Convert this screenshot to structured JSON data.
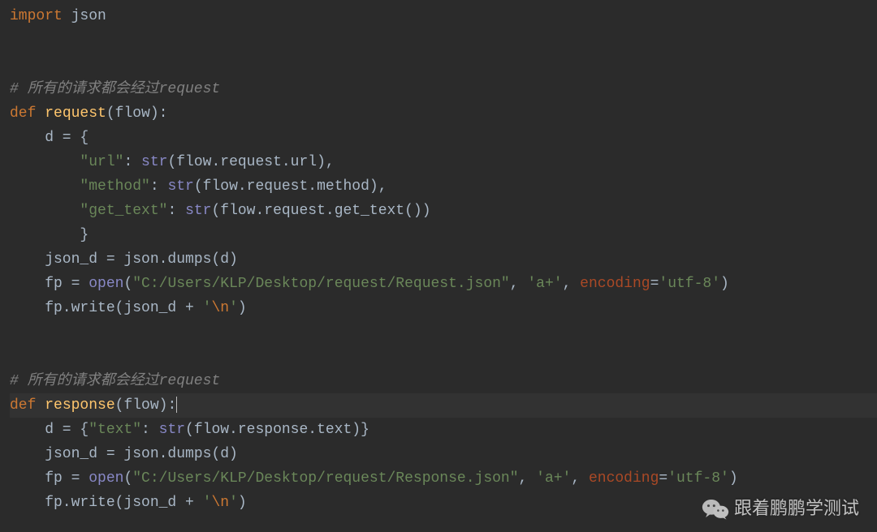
{
  "code": {
    "lines": [
      {
        "tokens": [
          {
            "t": "import ",
            "c": "kw"
          },
          {
            "t": "json",
            "c": "ident"
          }
        ]
      },
      {
        "tokens": []
      },
      {
        "tokens": []
      },
      {
        "tokens": [
          {
            "t": "# 所有的请求都会经过request",
            "c": "comment"
          }
        ]
      },
      {
        "tokens": [
          {
            "t": "def ",
            "c": "kw"
          },
          {
            "t": "request",
            "c": "def-name"
          },
          {
            "t": "(flow):",
            "c": "punct"
          }
        ]
      },
      {
        "tokens": [
          {
            "t": "    d = {",
            "c": "ident"
          }
        ]
      },
      {
        "tokens": [
          {
            "t": "        ",
            "c": "ident"
          },
          {
            "t": "\"url\"",
            "c": "str"
          },
          {
            "t": ": ",
            "c": "punct"
          },
          {
            "t": "str",
            "c": "builtin"
          },
          {
            "t": "(flow.request.url),",
            "c": "ident"
          }
        ]
      },
      {
        "tokens": [
          {
            "t": "        ",
            "c": "ident"
          },
          {
            "t": "\"method\"",
            "c": "str"
          },
          {
            "t": ": ",
            "c": "punct"
          },
          {
            "t": "str",
            "c": "builtin"
          },
          {
            "t": "(flow.request.method),",
            "c": "ident"
          }
        ]
      },
      {
        "tokens": [
          {
            "t": "        ",
            "c": "ident"
          },
          {
            "t": "\"get_text\"",
            "c": "str"
          },
          {
            "t": ": ",
            "c": "punct"
          },
          {
            "t": "str",
            "c": "builtin"
          },
          {
            "t": "(flow.request.get_text())",
            "c": "ident"
          }
        ]
      },
      {
        "tokens": [
          {
            "t": "        }",
            "c": "ident"
          }
        ]
      },
      {
        "tokens": [
          {
            "t": "    json_d = json.dumps(d)",
            "c": "ident"
          }
        ]
      },
      {
        "tokens": [
          {
            "t": "    fp = ",
            "c": "ident"
          },
          {
            "t": "open",
            "c": "builtin"
          },
          {
            "t": "(",
            "c": "punct"
          },
          {
            "t": "\"C:/Users/KLP/Desktop/request/Request.json\"",
            "c": "str"
          },
          {
            "t": ", ",
            "c": "punct"
          },
          {
            "t": "'a+'",
            "c": "str"
          },
          {
            "t": ", ",
            "c": "punct"
          },
          {
            "t": "encoding",
            "c": "kwarg"
          },
          {
            "t": "=",
            "c": "punct"
          },
          {
            "t": "'utf-8'",
            "c": "str"
          },
          {
            "t": ")",
            "c": "punct"
          }
        ]
      },
      {
        "tokens": [
          {
            "t": "    fp.write(json_d + ",
            "c": "ident"
          },
          {
            "t": "'",
            "c": "str"
          },
          {
            "t": "\\n",
            "c": "escape"
          },
          {
            "t": "'",
            "c": "str"
          },
          {
            "t": ")",
            "c": "punct"
          }
        ]
      },
      {
        "tokens": []
      },
      {
        "tokens": []
      },
      {
        "tokens": [
          {
            "t": "# 所有的请求都会经过request",
            "c": "comment"
          }
        ]
      },
      {
        "current": true,
        "tokens": [
          {
            "t": "def ",
            "c": "kw"
          },
          {
            "t": "response",
            "c": "def-name"
          },
          {
            "t": "(flow):",
            "c": "punct"
          },
          {
            "cursor": true
          }
        ]
      },
      {
        "tokens": [
          {
            "t": "    d = {",
            "c": "ident"
          },
          {
            "t": "\"text\"",
            "c": "str"
          },
          {
            "t": ": ",
            "c": "punct"
          },
          {
            "t": "str",
            "c": "builtin"
          },
          {
            "t": "(flow.response.text)}",
            "c": "ident"
          }
        ]
      },
      {
        "tokens": [
          {
            "t": "    json_d = json.dumps(d)",
            "c": "ident"
          }
        ]
      },
      {
        "tokens": [
          {
            "t": "    fp = ",
            "c": "ident"
          },
          {
            "t": "open",
            "c": "builtin"
          },
          {
            "t": "(",
            "c": "punct"
          },
          {
            "t": "\"C:/Users/KLP/Desktop/request/Response.json\"",
            "c": "str"
          },
          {
            "t": ", ",
            "c": "punct"
          },
          {
            "t": "'a+'",
            "c": "str"
          },
          {
            "t": ", ",
            "c": "punct"
          },
          {
            "t": "encoding",
            "c": "kwarg"
          },
          {
            "t": "=",
            "c": "punct"
          },
          {
            "t": "'utf-8'",
            "c": "str"
          },
          {
            "t": ")",
            "c": "punct"
          }
        ]
      },
      {
        "tokens": [
          {
            "t": "    fp.write(json_d + ",
            "c": "ident"
          },
          {
            "t": "'",
            "c": "str"
          },
          {
            "t": "\\n",
            "c": "escape"
          },
          {
            "t": "'",
            "c": "str"
          },
          {
            "t": ")",
            "c": "punct"
          }
        ]
      }
    ]
  },
  "watermark": {
    "text": "跟着鹏鹏学测试",
    "icon": "wechat-icon"
  }
}
